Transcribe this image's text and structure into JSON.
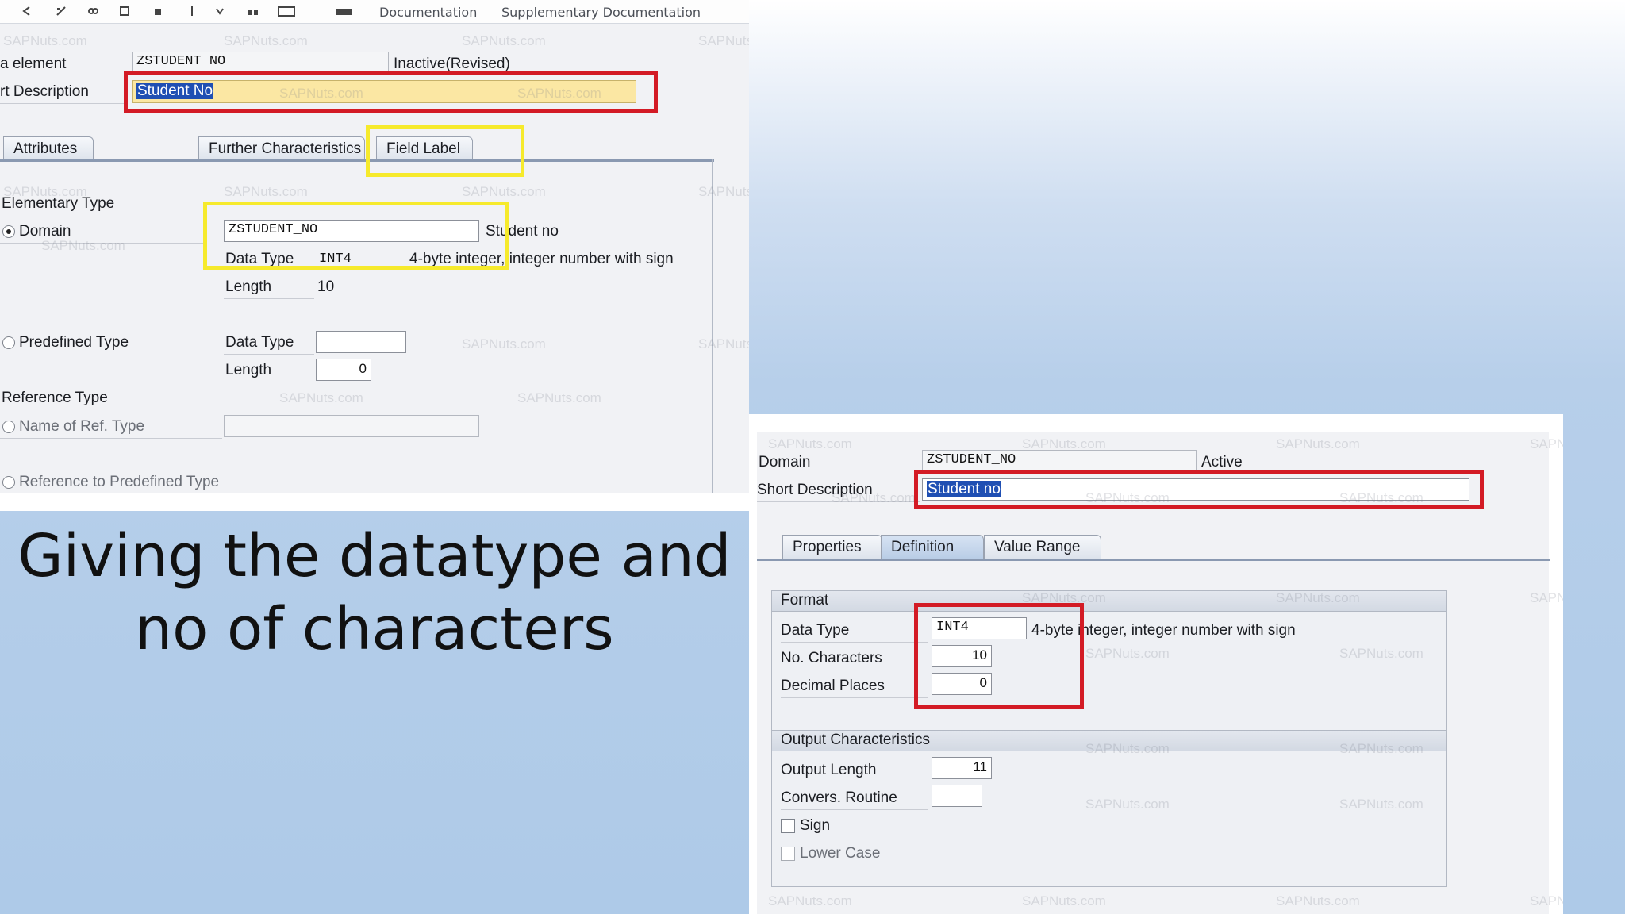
{
  "left_screen": {
    "toolbar_items": [
      "Documentation",
      "Supplementary Documentation"
    ],
    "data_element_label": "a element",
    "data_element_value": "ZSTUDENT NO",
    "data_element_status": "Inactive(Revised)",
    "short_description_label": "rt Description",
    "short_description_value": "Student No",
    "tabs": [
      "Attributes",
      "Further Characteristics",
      "Field Label"
    ],
    "elementary_type_label": "Elementary Type",
    "domain_radio_label": "Domain",
    "domain_value": "ZSTUDENT_NO",
    "domain_description": "Student no",
    "data_type_label": "Data Type",
    "data_type_value": "INT4",
    "data_type_description": "4-byte integer, integer number with sign",
    "length_label": "Length",
    "length_value": "10",
    "predefined_type_label": "Predefined Type",
    "predefined_data_type_label": "Data Type",
    "predefined_length_label": "Length",
    "predefined_length_value": "0",
    "reference_type_label": "Reference Type",
    "name_ref_type_label": "Name of Ref. Type",
    "ref_predefined_label": "Reference to Predefined Type",
    "watermark": "SAPNuts.com"
  },
  "caption": {
    "line1": "Giving the datatype and",
    "line2": "no of characters"
  },
  "right_screen": {
    "domain_label": "Domain",
    "domain_value": "ZSTUDENT_NO",
    "domain_status": "Active",
    "short_description_label": "Short Description",
    "short_description_value": "Student no",
    "tabs": [
      "Properties",
      "Definition",
      "Value Range"
    ],
    "format_group_title": "Format",
    "data_type_label": "Data Type",
    "data_type_value": "INT4",
    "data_type_description": "4-byte integer, integer number with sign",
    "no_characters_label": "No. Characters",
    "no_characters_value": "10",
    "decimal_places_label": "Decimal Places",
    "decimal_places_value": "0",
    "output_group_title": "Output Characteristics",
    "output_length_label": "Output Length",
    "output_length_value": "11",
    "convers_routine_label": "Convers. Routine",
    "sign_label": "Sign",
    "lower_case_label": "Lower Case",
    "watermark": "SAPNuts.com"
  },
  "colors": {
    "highlight_red": "#d31b25",
    "highlight_yellow": "#f6ea2c",
    "input_highlight": "#fbe7a3"
  }
}
